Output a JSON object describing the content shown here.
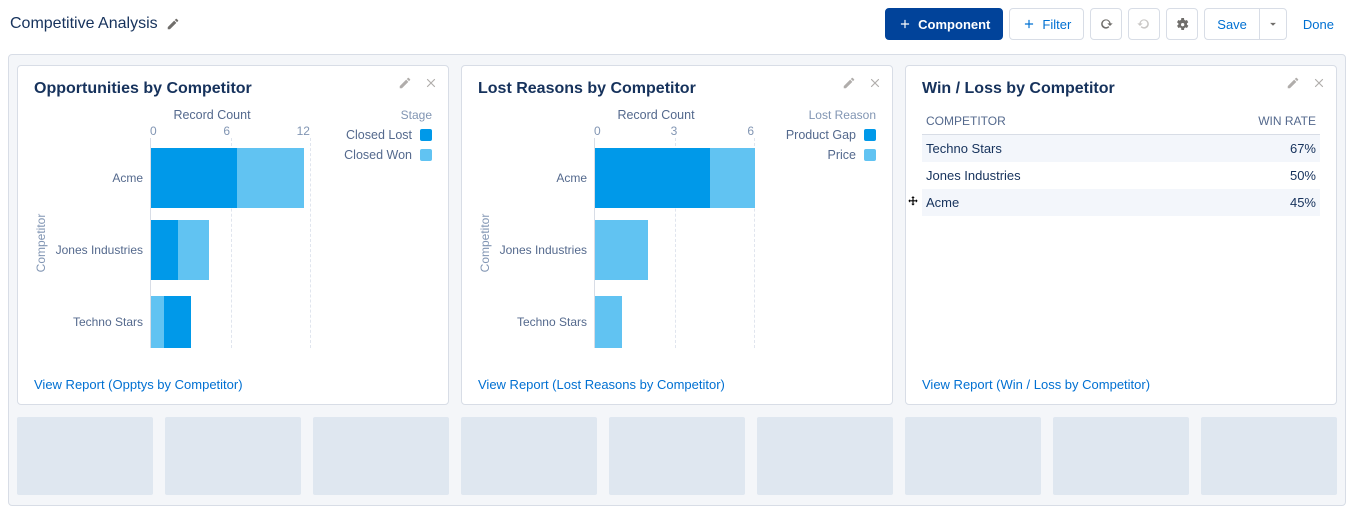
{
  "header": {
    "title": "Competitive Analysis",
    "component_btn": "Component",
    "filter_btn": "Filter",
    "save_btn": "Save",
    "done_btn": "Done"
  },
  "colors": {
    "series_a": "#0099e9",
    "series_b": "#61c3f2"
  },
  "cards": [
    {
      "title": "Opportunities by Competitor",
      "view_report": "View Report (Opptys by Competitor)"
    },
    {
      "title": "Lost Reasons by Competitor",
      "view_report": "View Report (Lost Reasons by Competitor)"
    },
    {
      "title": "Win / Loss by Competitor",
      "view_report": "View Report (Win / Loss by Competitor)"
    }
  ],
  "table": {
    "headers": [
      "COMPETITOR",
      "WIN RATE"
    ],
    "rows": [
      {
        "c": "Techno Stars",
        "w": "67%"
      },
      {
        "c": "Jones Industries",
        "w": "50%"
      },
      {
        "c": "Acme",
        "w": "45%"
      }
    ]
  },
  "chart_data": [
    {
      "type": "bar",
      "orientation": "horizontal",
      "stacked": true,
      "title": "Opportunities by Competitor",
      "xlabel": "Record Count",
      "ylabel": "Competitor",
      "legend_title": "Stage",
      "xticks": [
        0,
        6,
        12
      ],
      "xlim": [
        0,
        12
      ],
      "categories": [
        "Acme",
        "Jones Industries",
        "Techno Stars"
      ],
      "series": [
        {
          "name": "Closed Lost",
          "color": "#0099e9",
          "values": [
            6.5,
            2,
            1
          ]
        },
        {
          "name": "Closed Won",
          "color": "#61c3f2",
          "values": [
            5,
            2.3,
            2
          ]
        }
      ]
    },
    {
      "type": "bar",
      "orientation": "horizontal",
      "stacked": true,
      "title": "Lost Reasons by Competitor",
      "xlabel": "Record Count",
      "ylabel": "Competitor",
      "legend_title": "Lost Reason",
      "xticks": [
        0,
        3,
        6
      ],
      "xlim": [
        0,
        6
      ],
      "categories": [
        "Acme",
        "Jones Industries",
        "Techno Stars"
      ],
      "series": [
        {
          "name": "Product Gap",
          "color": "#0099e9",
          "values": [
            4.3,
            0,
            0
          ]
        },
        {
          "name": "Price",
          "color": "#61c3f2",
          "values": [
            1.7,
            2,
            1
          ]
        }
      ]
    }
  ]
}
